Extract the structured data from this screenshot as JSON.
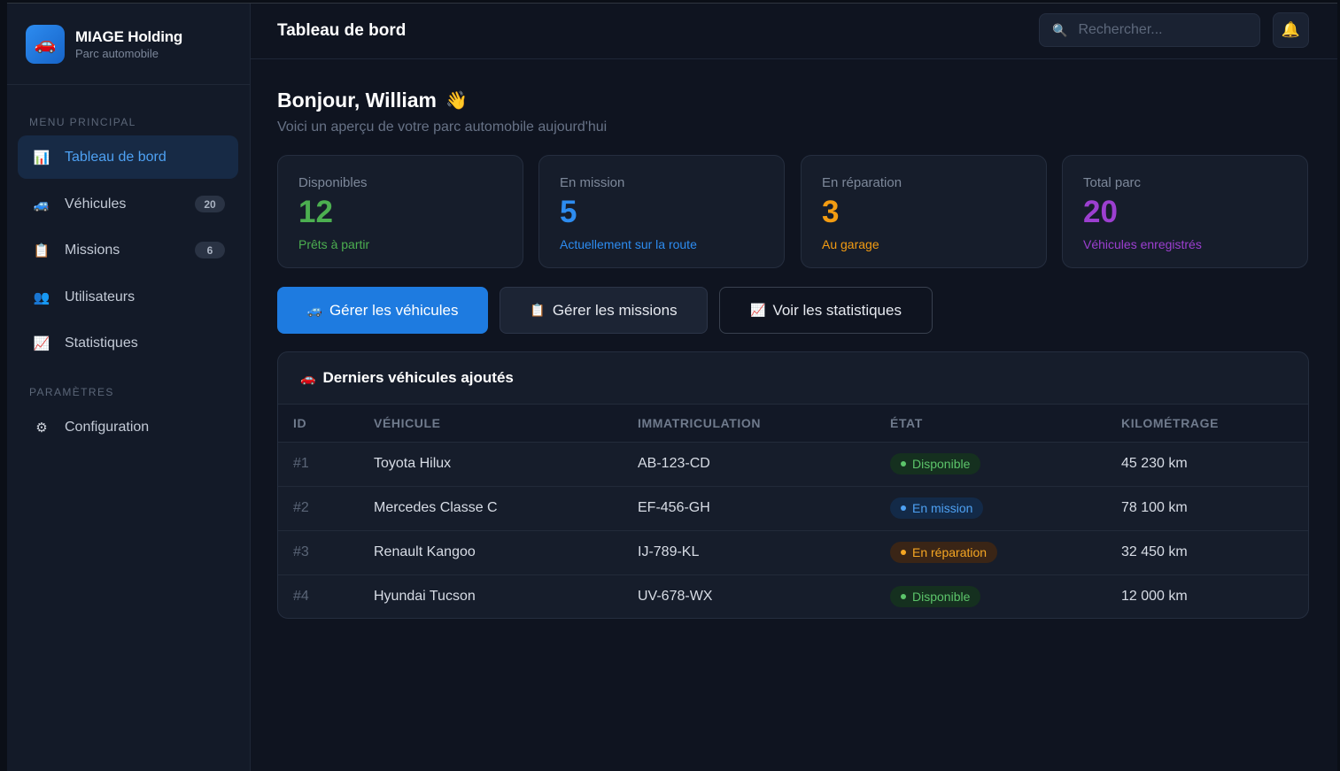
{
  "brand": {
    "name": "MIAGE Holding",
    "subtitle": "Parc automobile",
    "logo_icon": "car-icon"
  },
  "sidebar": {
    "main_section_label": "MENU PRINCIPAL",
    "items": [
      {
        "label": "Tableau de bord",
        "icon": "📊",
        "icon_name": "chart-icon",
        "active": true
      },
      {
        "label": "Véhicules",
        "icon": "🚙",
        "icon_name": "car-icon",
        "badge": "20"
      },
      {
        "label": "Missions",
        "icon": "📋",
        "icon_name": "clipboard-icon",
        "badge": "6"
      },
      {
        "label": "Utilisateurs",
        "icon": "👥",
        "icon_name": "users-icon"
      },
      {
        "label": "Statistiques",
        "icon": "📈",
        "icon_name": "trend-icon"
      }
    ],
    "settings_section_label": "PARAMÈTRES",
    "settings_items": [
      {
        "label": "Configuration",
        "icon": "⚙",
        "icon_name": "gear-icon"
      }
    ]
  },
  "topbar": {
    "title": "Tableau de bord",
    "search_placeholder": "Rechercher...",
    "bell_icon": "🔔"
  },
  "greeting": {
    "title": "Bonjour, William",
    "emoji": "👋",
    "subtitle": "Voici un aperçu de votre parc automobile aujourd'hui"
  },
  "stats": [
    {
      "label": "Disponibles",
      "value": "12",
      "note": "Prêts à partir",
      "color": "#4caf50"
    },
    {
      "label": "En mission",
      "value": "5",
      "note": "Actuellement sur la route",
      "color": "#2d8cf0"
    },
    {
      "label": "En réparation",
      "value": "3",
      "note": "Au garage",
      "color": "#f39c12"
    },
    {
      "label": "Total parc",
      "value": "20",
      "note": "Véhicules enregistrés",
      "color": "#9c3fd0"
    }
  ],
  "actions": [
    {
      "label": "Gérer les véhicules",
      "icon": "🚙"
    },
    {
      "label": "Gérer les missions",
      "icon": "📋"
    },
    {
      "label": "Voir les statistiques",
      "icon": "📈"
    }
  ],
  "recent": {
    "title": "Derniers véhicules ajoutés",
    "icon": "🚗",
    "columns": [
      "ID",
      "VÉHICULE",
      "IMMATRICULATION",
      "ÉTAT",
      "KILOMÉTRAGE"
    ],
    "rows": [
      {
        "id": "#1",
        "vehicle": "Toyota Hilux",
        "plate": "AB-123-CD",
        "status": "Disponible",
        "status_color": "#4caf50",
        "km": "45 230 km"
      },
      {
        "id": "#2",
        "vehicle": "Mercedes Classe C",
        "plate": "EF-456-GH",
        "status": "En mission",
        "status_color": "#2d8cf0",
        "km": "78 100 km"
      },
      {
        "id": "#3",
        "vehicle": "Renault Kangoo",
        "plate": "IJ-789-KL",
        "status": "En réparation",
        "status_color": "#f39c12",
        "km": "32 450 km"
      },
      {
        "id": "#4",
        "vehicle": "Hyundai Tucson",
        "plate": "UV-678-WX",
        "status": "Disponible",
        "status_color": "#4caf50",
        "km": "12 000 km"
      }
    ]
  }
}
